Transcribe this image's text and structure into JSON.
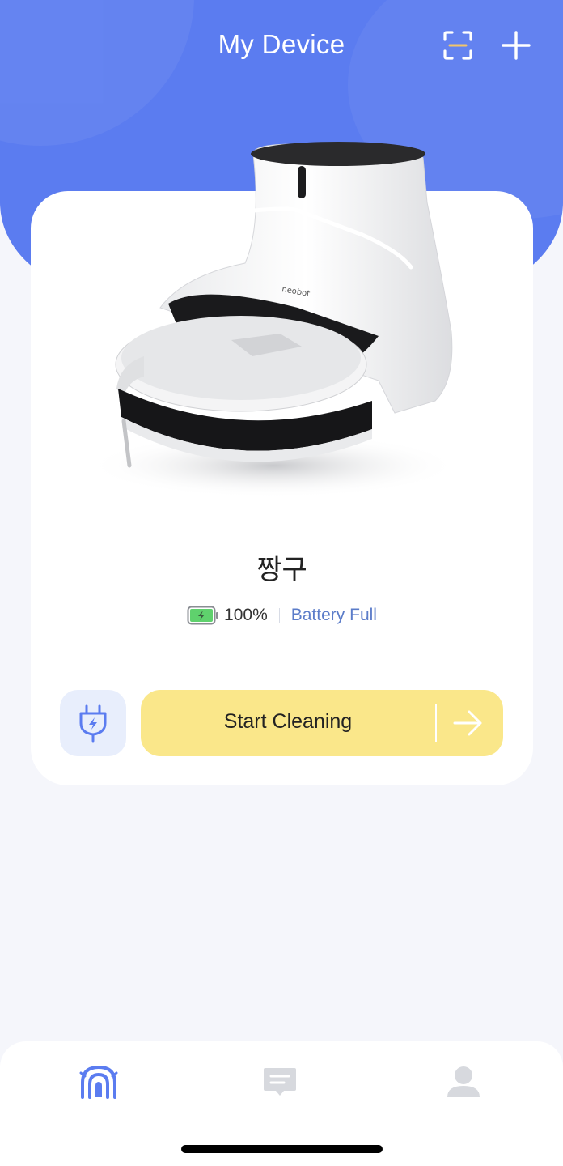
{
  "header": {
    "title": "My Device",
    "scan_icon": "scan-icon",
    "add_icon": "plus-icon"
  },
  "device": {
    "name": "짱구",
    "image": "robot-vacuum-with-dock",
    "brand_mark": "neobot",
    "battery_percent": "100%",
    "battery_level": 1.0,
    "battery_status": "Battery Full"
  },
  "actions": {
    "charge_icon": "plug-icon",
    "start_label": "Start Cleaning",
    "start_arrow_icon": "arrow-right-icon"
  },
  "tabbar": {
    "items": [
      {
        "name": "home-tab",
        "icon": "robot-home-icon",
        "active": true
      },
      {
        "name": "messages-tab",
        "icon": "message-icon",
        "active": false
      },
      {
        "name": "profile-tab",
        "icon": "user-icon",
        "active": false
      }
    ]
  },
  "colors": {
    "brand": "#5b7cf0",
    "start_button": "#fae78a",
    "battery_status": "#5b7cc9",
    "battery_fill": "#5fd16d",
    "background": "#f5f6fb"
  }
}
